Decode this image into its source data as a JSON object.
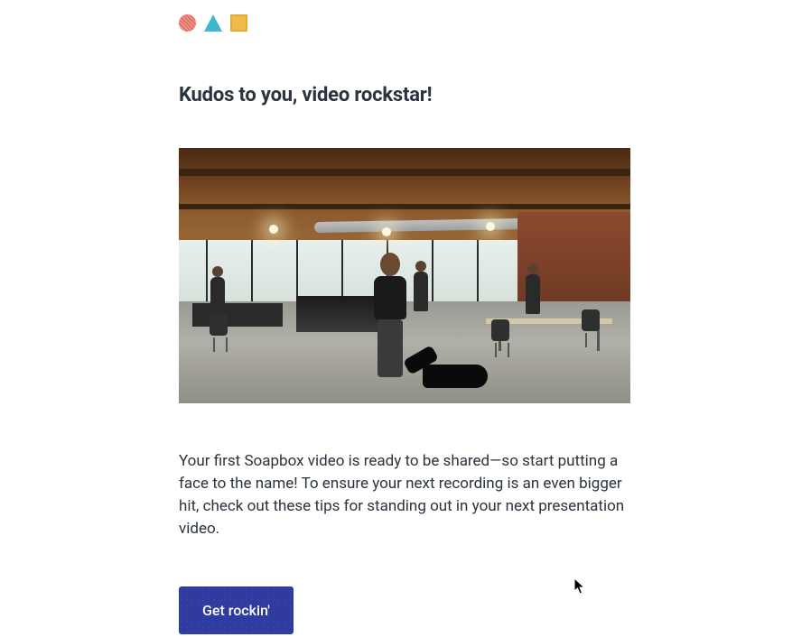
{
  "logo": {
    "shapes": [
      "circle",
      "triangle",
      "square"
    ],
    "colors": {
      "circle": "#e88780",
      "triangle": "#3fb8cc",
      "square": "#f0bb4b"
    }
  },
  "heading": "Kudos to you, video rockstar!",
  "hero_alt": "Person playing air guitar in an open loft office with exposed wood ceiling, a guitar case on the floor",
  "body": "Your first Soapbox video is ready to be shared—so start putting a face to the name! To ensure your next recording is an even bigger hit, check out these tips for standing out in your next presentation video.",
  "cta": {
    "label": "Get rockin'",
    "bg": "#2f3b9e"
  }
}
